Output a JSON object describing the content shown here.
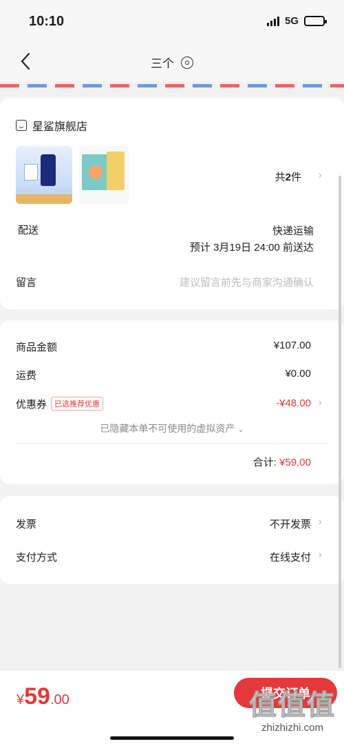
{
  "status_bar": {
    "time": "10:10",
    "network": "5G"
  },
  "nav": {
    "title": "三个"
  },
  "order": {
    "store_name": "星鲨旗舰店",
    "item_count_prefix": "共",
    "item_count": "2",
    "item_count_suffix": "件",
    "delivery_label": "配送",
    "delivery_method": "快递运输",
    "delivery_eta": "预计 3月19日 24:00 前送达",
    "message_label": "留言",
    "message_placeholder": "建议留言前先与商家沟通确认"
  },
  "summary": {
    "goods_label": "商品金额",
    "goods_value": "¥107.00",
    "shipping_label": "运费",
    "shipping_value": "¥0.00",
    "coupon_label": "优惠券",
    "coupon_badge": "已选推荐优惠",
    "coupon_value": "-¥48.00",
    "hidden_note": "已隐藏本单不可使用的虚拟资产",
    "total_label": "合计:",
    "total_value": "¥59.00"
  },
  "extra": {
    "invoice_label": "发票",
    "invoice_value": "不开发票",
    "payment_label": "支付方式",
    "payment_value": "在线支付"
  },
  "footer": {
    "pay_symbol": "¥",
    "pay_int": "59",
    "pay_dec": ".00",
    "submit_label": "提交订单"
  },
  "watermark": {
    "logo": "值",
    "site": "zhizhizhi.com"
  },
  "colors": {
    "accent": "#e4393c",
    "page_bg": "#f2f2f2"
  }
}
